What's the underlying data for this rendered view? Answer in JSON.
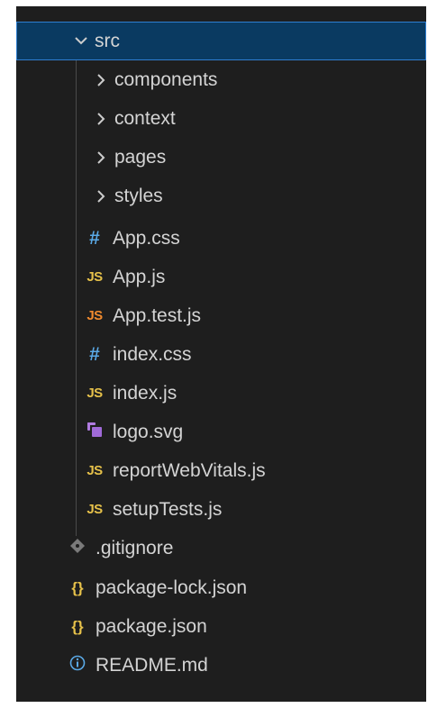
{
  "explorer": {
    "root_folder": {
      "label": "src",
      "expanded": true
    },
    "subfolders": [
      {
        "label": "components"
      },
      {
        "label": "context"
      },
      {
        "label": "pages"
      },
      {
        "label": "styles"
      }
    ],
    "src_files": [
      {
        "label": "App.css",
        "icon": "css-hash-icon",
        "badge": "#"
      },
      {
        "label": "App.js",
        "icon": "js-icon",
        "badge": "JS"
      },
      {
        "label": "App.test.js",
        "icon": "js-test-icon",
        "badge": "JS"
      },
      {
        "label": "index.css",
        "icon": "css-hash-icon",
        "badge": "#"
      },
      {
        "label": "index.js",
        "icon": "js-icon",
        "badge": "JS"
      },
      {
        "label": "logo.svg",
        "icon": "svg-logo-icon",
        "badge": ""
      },
      {
        "label": "reportWebVitals.js",
        "icon": "js-icon",
        "badge": "JS"
      },
      {
        "label": "setupTests.js",
        "icon": "js-icon",
        "badge": "JS"
      }
    ],
    "root_files": [
      {
        "label": ".gitignore",
        "icon": "git-icon"
      },
      {
        "label": "package-lock.json",
        "icon": "json-braces-icon",
        "badge": "{}"
      },
      {
        "label": "package.json",
        "icon": "json-braces-icon",
        "badge": "{}"
      },
      {
        "label": "README.md",
        "icon": "info-icon"
      }
    ],
    "colors": {
      "background": "#1e1e1e",
      "selected_row": "#0a3a61",
      "selected_border": "#2f7ed0",
      "css_icon": "#5aa9e6",
      "js_icon": "#e6c14a",
      "js_test_icon": "#f08a2e",
      "svg_icon": "#b07be0"
    }
  }
}
